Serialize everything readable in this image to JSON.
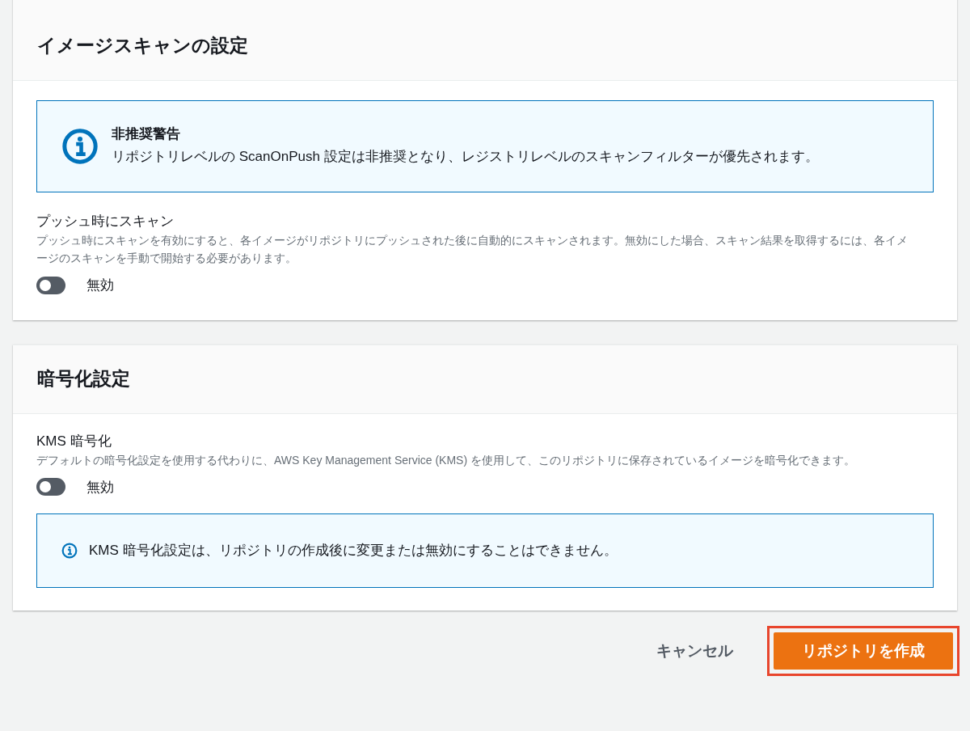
{
  "sections": [
    {
      "title": "イメージスキャンの設定",
      "alert": {
        "kind": "large",
        "title": "非推奨警告",
        "text": "リポジトリレベルの ScanOnPush 設定は非推奨となり、レジストリレベルのスキャンフィルターが優先されます。"
      },
      "setting": {
        "label": "プッシュ時にスキャン",
        "description": "プッシュ時にスキャンを有効にすると、各イメージがリポジトリにプッシュされた後に自動的にスキャンされます。無効にした場合、スキャン結果を取得するには、各イメージのスキャンを手動で開始する必要があります。",
        "on": false,
        "state_label": "無効"
      }
    },
    {
      "title": "暗号化設定",
      "setting": {
        "label": "KMS 暗号化",
        "description": "デフォルトの暗号化設定を使用する代わりに、AWS Key Management Service (KMS) を使用して、このリポジトリに保存されているイメージを暗号化できます。",
        "on": false,
        "state_label": "無効"
      },
      "alert": {
        "kind": "small",
        "text": "KMS 暗号化設定は、リポジトリの作成後に変更または無効にすることはできません。"
      }
    }
  ],
  "actions": {
    "cancel": "キャンセル",
    "create": "リポジトリを作成",
    "create_highlighted": true
  }
}
